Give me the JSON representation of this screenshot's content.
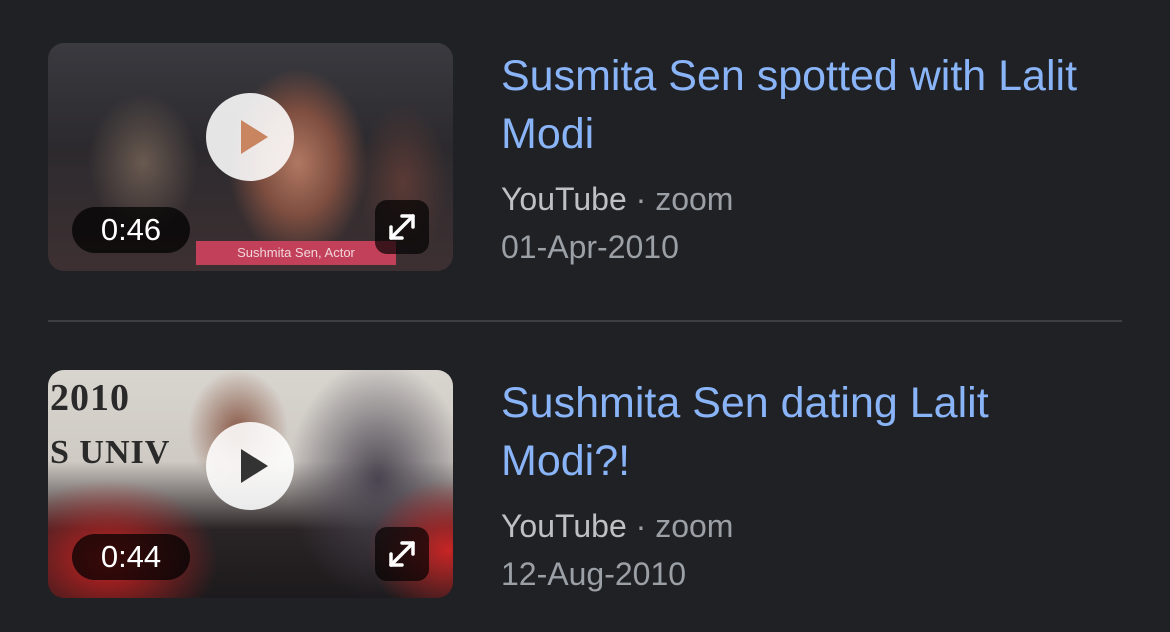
{
  "results": [
    {
      "title": "Susmita Sen spotted with Lalit Modi",
      "source": "YouTube",
      "separator": "·",
      "channel": "zoom",
      "date": "01-Apr-2010",
      "duration": "0:46",
      "thumbnail_caption": "Sushmita Sen, Actor"
    },
    {
      "title": "Sushmita Sen dating Lalit Modi?!",
      "source": "YouTube",
      "separator": "·",
      "channel": "zoom",
      "date": "12-Aug-2010",
      "duration": "0:44",
      "thumbnail_backdrop": [
        "2010",
        "S UNIV"
      ]
    }
  ],
  "icons": {
    "play": "play-icon",
    "expand": "expand-icon"
  },
  "colors": {
    "background": "#202124",
    "title_link": "#8ab4f8",
    "source_text": "#bdc1c6",
    "meta_text": "#9aa0a6",
    "divider": "#3c4043"
  }
}
